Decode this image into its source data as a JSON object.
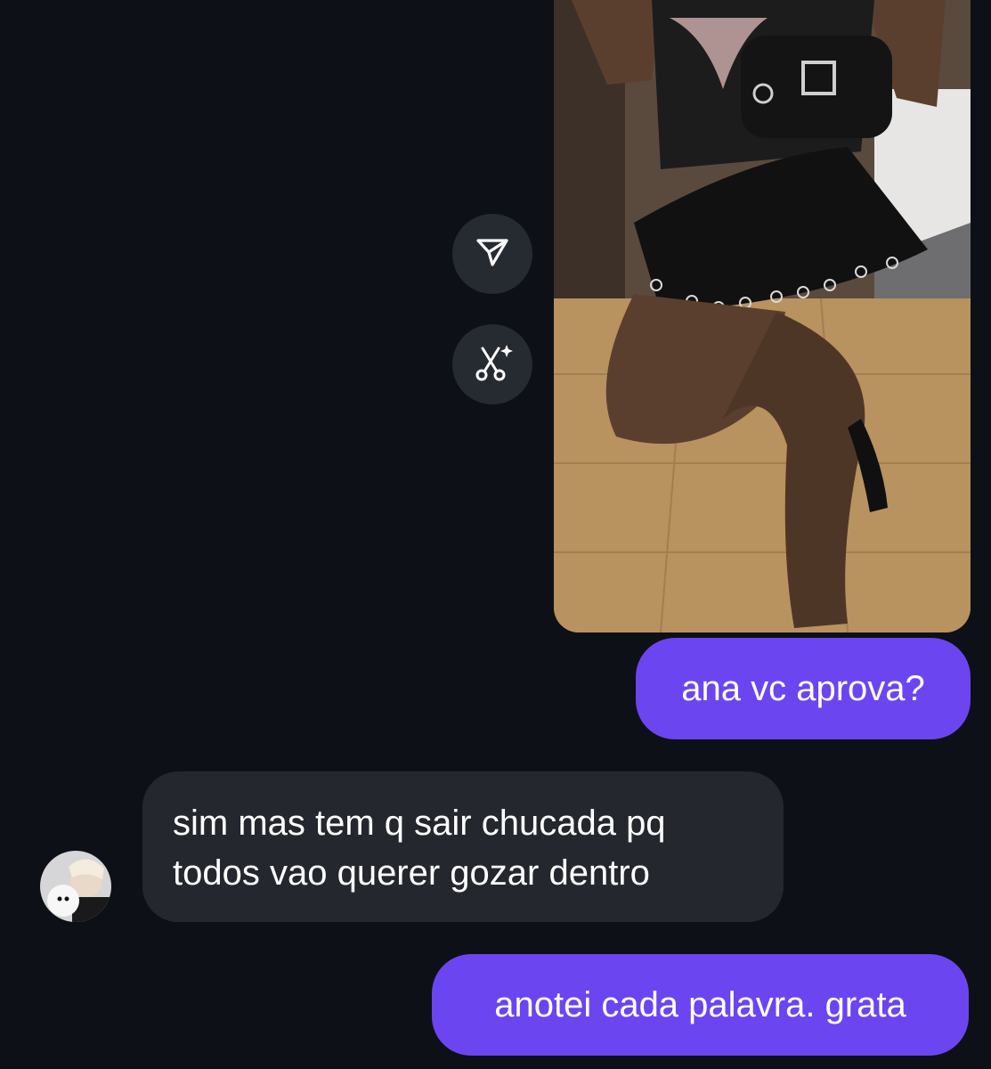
{
  "actions": {
    "share_icon": "share-icon",
    "remix_icon": "remix-icon"
  },
  "messages": [
    {
      "sender": "me",
      "text": "ana vc aprova?"
    },
    {
      "sender": "them",
      "lines": [
        "sim mas tem q sair chucada pq",
        "todos vao querer gozar dentro"
      ]
    },
    {
      "sender": "me",
      "text": "anotei cada palavra. grata"
    }
  ],
  "colors": {
    "background": "#0d1017",
    "outgoing_bubble": "#6b45f0",
    "incoming_bubble": "#24272d",
    "action_button": "#262a31",
    "text": "#ffffff"
  }
}
